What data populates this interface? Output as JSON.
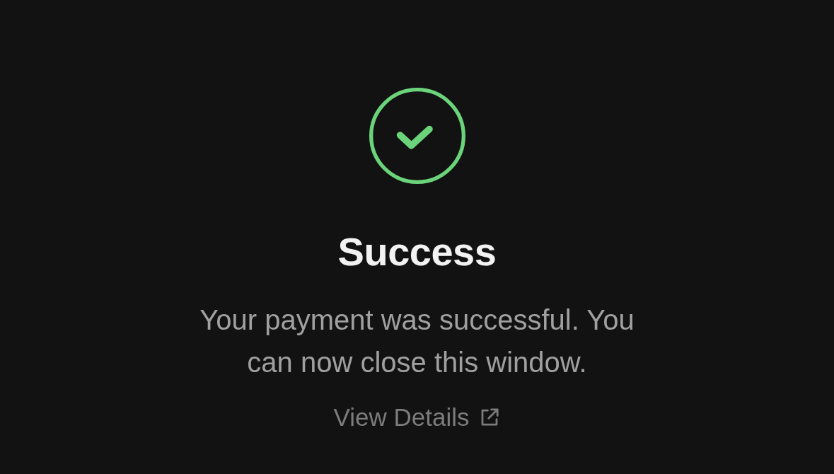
{
  "status": {
    "kind": "success"
  },
  "title": "Success",
  "message": "Your payment was successful. You can now close this window.",
  "link": {
    "label": "View Details"
  }
}
